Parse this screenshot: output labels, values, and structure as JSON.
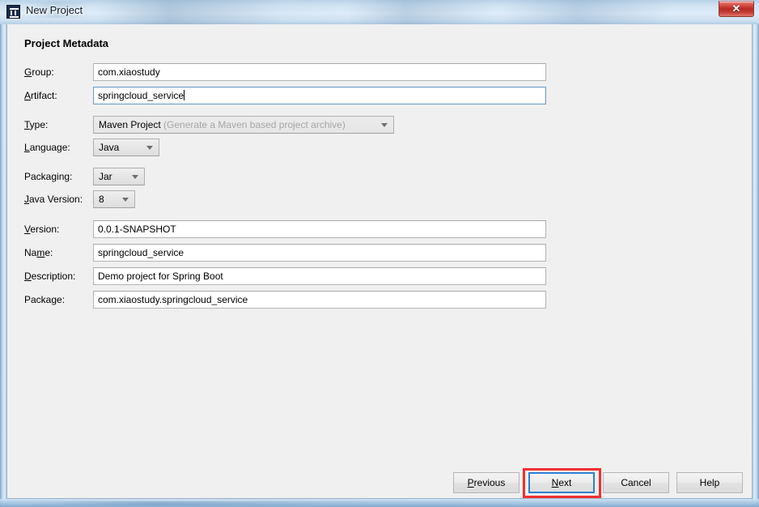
{
  "window": {
    "title": "New Project",
    "app_icon": "intellij-idea-icon",
    "close_label": "✕",
    "close_color": "#b62b24"
  },
  "dialog": {
    "section_title": "Project Metadata",
    "fields": [
      {
        "key": "group",
        "label": "Group:",
        "mnemonic": "G",
        "value": "com.xiaostudy",
        "type": "text",
        "focused": false
      },
      {
        "key": "artifact",
        "label": "Artifact:",
        "mnemonic": "A",
        "value": "springcloud_service",
        "type": "text",
        "focused": true
      },
      {
        "key": "type",
        "label": "Type:",
        "mnemonic": "T",
        "value": "Maven Project",
        "hint": "(Generate a Maven based project archive)",
        "type": "combo",
        "focused": false
      },
      {
        "key": "language",
        "label": "Language:",
        "mnemonic": "L",
        "value": "Java",
        "type": "combo",
        "focused": false
      },
      {
        "key": "packaging",
        "label": "Packaging:",
        "mnemonic": "g",
        "value": "Jar",
        "type": "combo",
        "focused": false
      },
      {
        "key": "javaver",
        "label": "Java Version:",
        "mnemonic": "J",
        "value": "8",
        "type": "combo",
        "focused": false
      },
      {
        "key": "version",
        "label": "Version:",
        "mnemonic": "V",
        "value": "0.0.1-SNAPSHOT",
        "type": "text",
        "focused": false
      },
      {
        "key": "name",
        "label": "Name:",
        "mnemonic": "m",
        "value": "springcloud_service",
        "type": "text",
        "focused": false
      },
      {
        "key": "descr",
        "label": "Description:",
        "mnemonic": "D",
        "value": "Demo project for Spring Boot",
        "type": "text",
        "focused": false
      },
      {
        "key": "package",
        "label": "Package:",
        "mnemonic": "",
        "value": "com.xiaostudy.springcloud_service",
        "type": "text",
        "focused": false
      }
    ],
    "labels": {
      "group": "Group:",
      "artifact": "Artifact:",
      "type": "Type:",
      "language": "Language:",
      "packaging": "Packaging:",
      "java_version": "Java Version:",
      "version": "Version:",
      "name": "Name:",
      "description": "Description:",
      "package": "Package:"
    },
    "values": {
      "group": "com.xiaostudy",
      "artifact": "springcloud_service",
      "type": "Maven Project",
      "type_hint": "(Generate a Maven based project archive)",
      "language": "Java",
      "packaging": "Jar",
      "java_version": "8",
      "version": "0.0.1-SNAPSHOT",
      "name": "springcloud_service",
      "description": "Demo project for Spring Boot",
      "package": "com.xiaostudy.springcloud_service"
    },
    "buttons": {
      "previous": "Previous",
      "next": "Next",
      "cancel": "Cancel",
      "help": "Help",
      "default_button": "next"
    },
    "annotation": {
      "target": "next-button",
      "color": "#f03030",
      "shape": "rectangle"
    }
  }
}
